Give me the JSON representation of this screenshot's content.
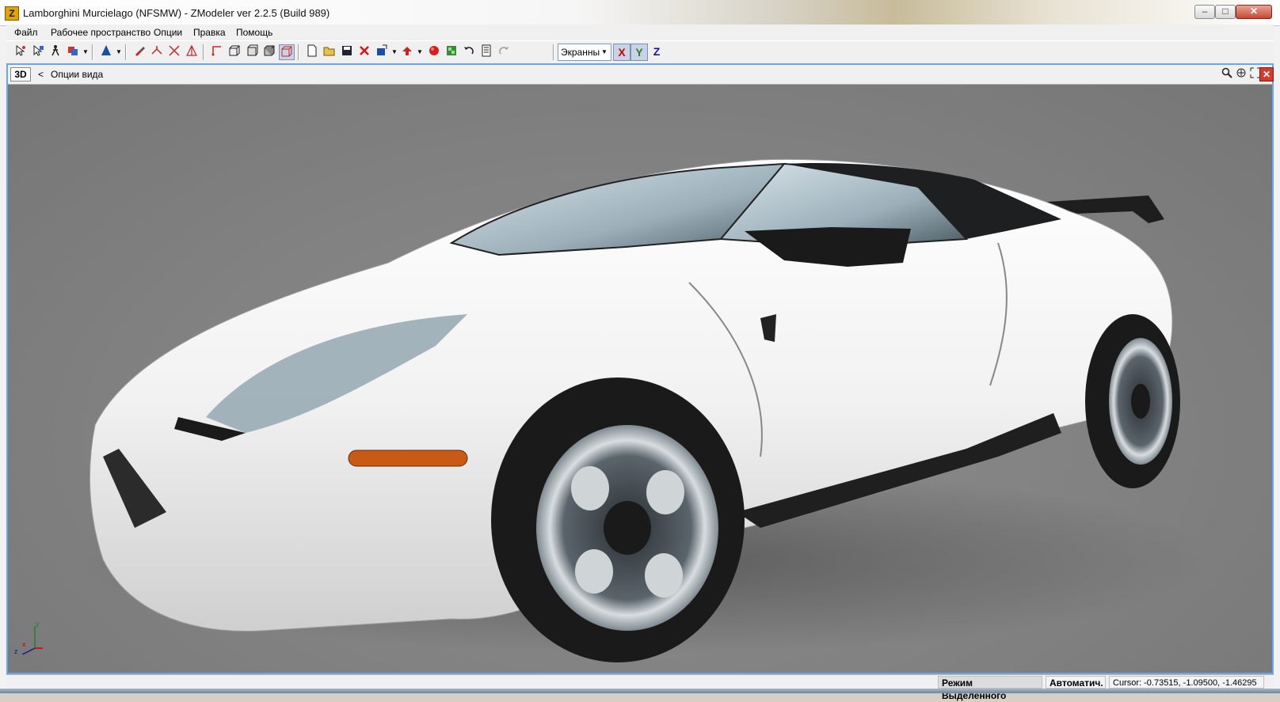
{
  "window": {
    "title": "Lamborghini Murcielago  (NFSMW) - ZModeler ver 2.2.5 (Build 989)",
    "app_icon_letter": "Z",
    "minimize": "–",
    "maximize": "□",
    "close": "✕"
  },
  "menu": {
    "items": [
      "Файл",
      "Рабочее пространство",
      "Опции",
      "Правка",
      "Помощь"
    ]
  },
  "toolbar": {
    "view_mode_selected": "Экранны",
    "axes": [
      "X",
      "Y",
      "Z"
    ]
  },
  "viewport": {
    "view_label": "3D",
    "options_chevron": "<",
    "options_label": "Опции вида",
    "gizmo_axes": [
      "y",
      "x",
      "z"
    ]
  },
  "statusbar": {
    "mode": "Режим Выделенного",
    "auto": "Автоматич.",
    "cursor": "Cursor: -0.73515, -1.09500, -1.46295"
  },
  "colors": {
    "viewport_border": "#6aa6e8",
    "scene_bg": "#808080",
    "axis_x": "#cc0000",
    "axis_y": "#2d7d2d",
    "axis_z": "#1a1a8a"
  }
}
